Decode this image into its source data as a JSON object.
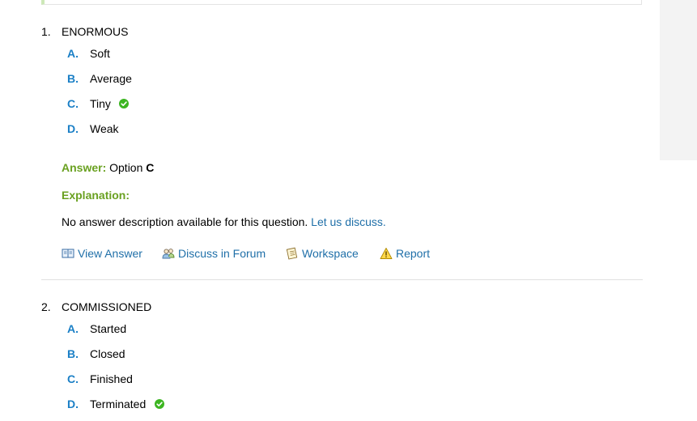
{
  "questions": [
    {
      "number": "1.",
      "word": "ENORMOUS",
      "options": [
        {
          "letter": "A.",
          "text": "Soft",
          "correct": false
        },
        {
          "letter": "B.",
          "text": "Average",
          "correct": false
        },
        {
          "letter": "C.",
          "text": "Tiny",
          "correct": true
        },
        {
          "letter": "D.",
          "text": "Weak",
          "correct": false
        }
      ],
      "answer_label": "Answer:",
      "answer_prefix": "Option",
      "answer_option": "C",
      "explanation_label": "Explanation:",
      "explanation_text": "No answer description available for this question.",
      "discuss_link": "Let us discuss.",
      "actions": [
        {
          "label": "View Answer",
          "icon": "book-icon"
        },
        {
          "label": "Discuss in Forum",
          "icon": "users-icon"
        },
        {
          "label": "Workspace",
          "icon": "notepad-icon"
        },
        {
          "label": "Report",
          "icon": "warning-icon"
        }
      ]
    },
    {
      "number": "2.",
      "word": "COMMISSIONED",
      "options": [
        {
          "letter": "A.",
          "text": "Started",
          "correct": false
        },
        {
          "letter": "B.",
          "text": "Closed",
          "correct": false
        },
        {
          "letter": "C.",
          "text": "Finished",
          "correct": false
        },
        {
          "letter": "D.",
          "text": "Terminated",
          "correct": true
        }
      ]
    }
  ],
  "colors": {
    "option_letter": "#1a7fc6",
    "answer_green": "#6aa121",
    "link_blue": "#1f6fa8",
    "check_green": "#3cb521"
  }
}
